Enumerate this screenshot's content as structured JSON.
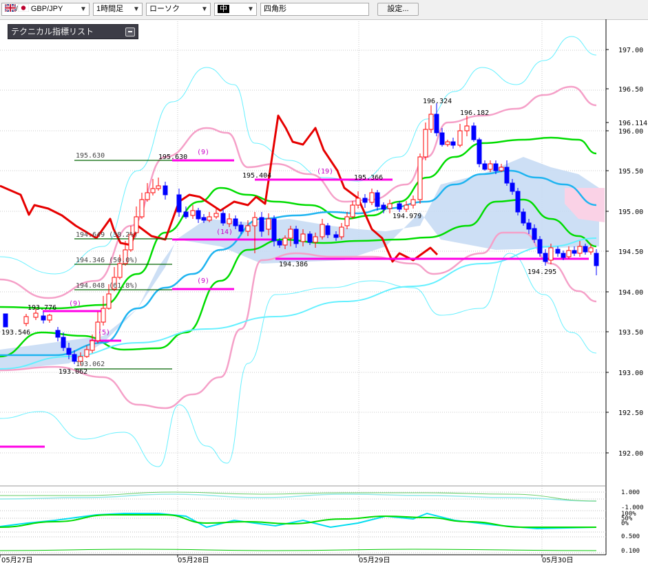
{
  "toolbar": {
    "symbol": "GBP/JPY",
    "timeframe": "1時間足",
    "chart_type": "ローソク",
    "size": "中",
    "draw_shape": "四角形",
    "settings_label": "設定..."
  },
  "indicator_panel": {
    "title": "テクニカル指標リスト"
  },
  "price_axis": {
    "labels": [
      "197.00",
      "196.50",
      "196.114",
      "196.00",
      "195.50",
      "195.00",
      "194.50",
      "194.00",
      "193.50",
      "193.00",
      "192.50",
      "192.00"
    ]
  },
  "sub_axis": {
    "labels": [
      "1.000",
      "-1.000",
      "100%",
      "50%",
      "0%",
      "0.500",
      "0.100"
    ]
  },
  "time_axis": {
    "labels": [
      "05月27日",
      "05月28日",
      "05月29日",
      "05月30日"
    ]
  },
  "annotations": {
    "fib": [
      "195.630",
      "194.649 (38.2%)",
      "194.346 (50.0%)",
      "194.048 (61.8%)",
      "193.062"
    ],
    "price_labels": [
      "195.630",
      "195.404",
      "195.366",
      "194.979",
      "196.324",
      "196.182",
      "194.386",
      "194.295",
      "193.776",
      "193.546",
      "193.062"
    ],
    "counts": [
      "(9)",
      "(19)",
      "(14)",
      "(9)",
      "(9)",
      "(5)"
    ]
  },
  "colors": {
    "bull_candle": "#ff0000",
    "bear_candle": "#0000ff",
    "cloud": "#c8dcf4",
    "cloud_pink": "#fad2e6",
    "sma_blue": "#1eb4f0",
    "sma_green": "#00dc00",
    "bollinger_pink": "#f5a0c8",
    "bollinger_cyan": "#64f0ff",
    "red_line": "#e60000",
    "magenta_line": "#ff00e6",
    "fib_line": "#006400"
  },
  "chart_data": {
    "type": "candlestick",
    "series": [],
    "ylim": [
      191.7,
      197.2
    ],
    "x": [
      "05月27日",
      "05月28日",
      "05月29日",
      "05月30日"
    ]
  }
}
